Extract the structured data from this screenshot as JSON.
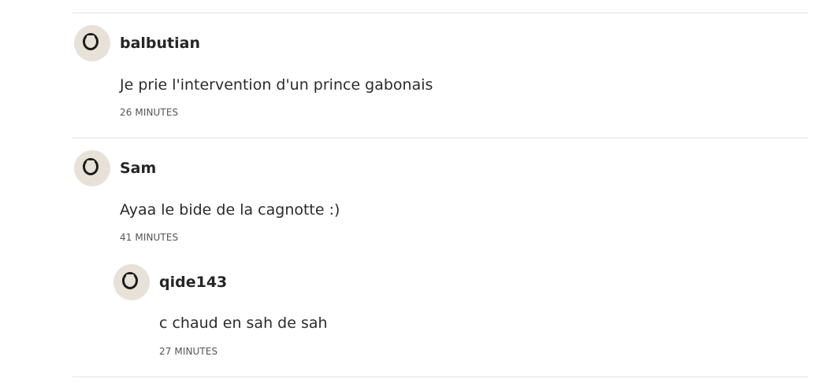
{
  "comments": [
    {
      "username": "balbutian",
      "avatar_icon": "user-avatar-icon",
      "text": "Je prie l'intervention d'un prince gabonais",
      "time": "26 MINUTES",
      "replies": []
    },
    {
      "username": "Sam",
      "avatar_icon": "user-avatar-icon",
      "text": "Ayaa le bide de la cagnotte :)",
      "time": "41 MINUTES",
      "replies": [
        {
          "username": "qide143",
          "avatar_icon": "user-avatar-icon",
          "text": "c chaud en sah de sah",
          "time": "27 MINUTES"
        }
      ]
    }
  ],
  "colors": {
    "avatar_bg": "#e8e1d8",
    "divider": "#e2e2e2",
    "text": "#2b2b2b"
  }
}
